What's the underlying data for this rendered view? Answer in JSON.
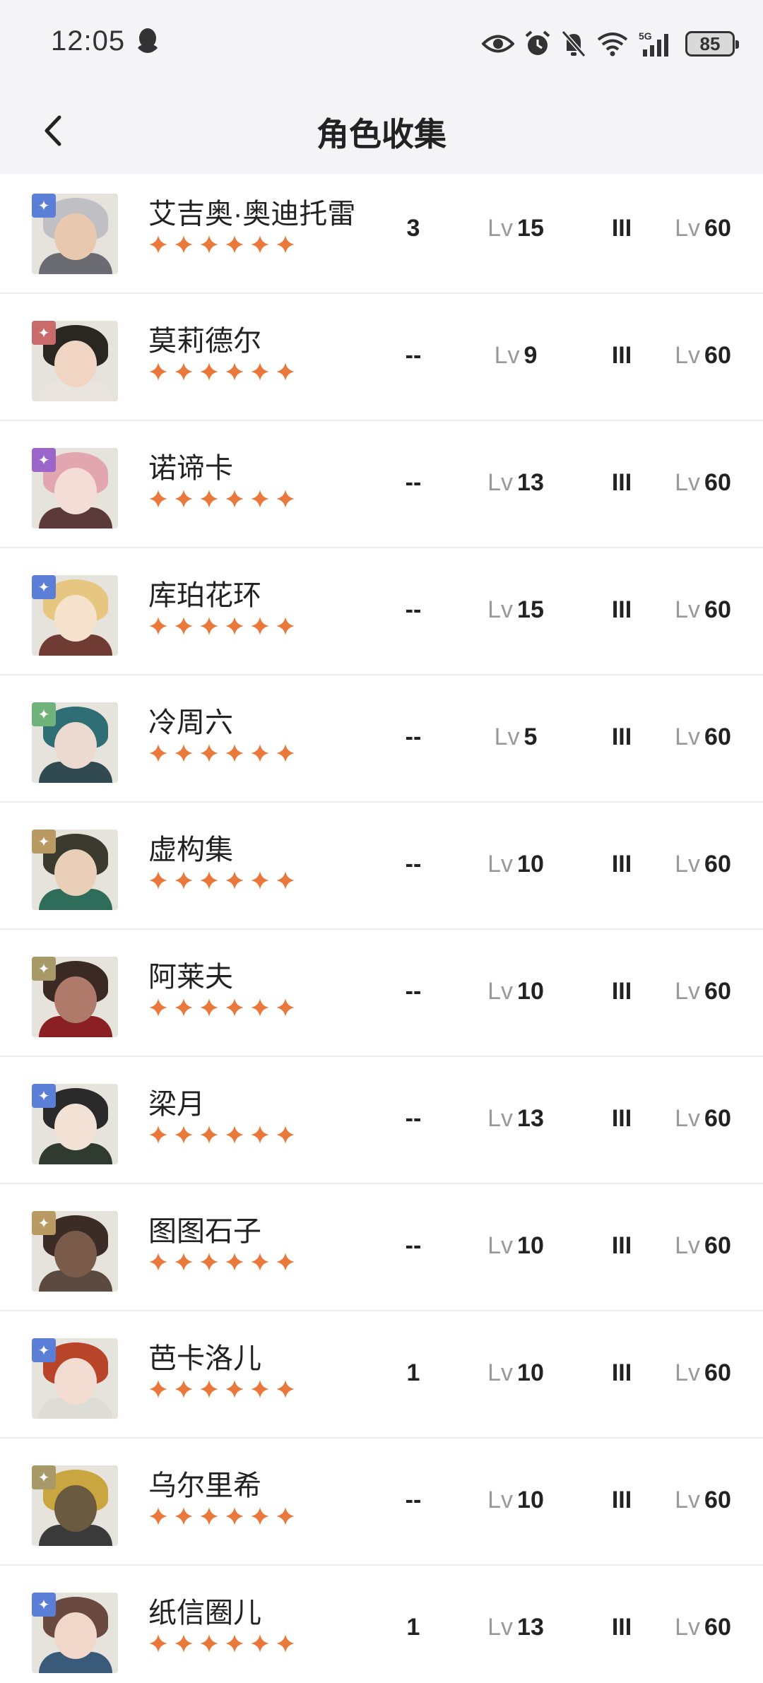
{
  "status_bar": {
    "time": "12:05",
    "battery": "85",
    "icons": [
      "qq-icon",
      "eye-icon",
      "alarm-icon",
      "bell-off-icon",
      "wifi-icon",
      "5g-icon",
      "signal-icon",
      "battery-icon"
    ]
  },
  "header": {
    "title": "角色收集",
    "back_icon": "chevron-left-icon"
  },
  "colors": {
    "star": "#e9783a",
    "divider": "#ececec",
    "element_blue": "#5b7fd6",
    "element_red": "#c96b6b",
    "element_purple": "#9b65c9",
    "element_green": "#6fb27a",
    "element_gold": "#b89a62"
  },
  "lv_prefix": "Lv",
  "characters": [
    {
      "name": "艾吉奥·奥迪托雷",
      "element": "star-element-icon",
      "element_color": "#5b7fd6",
      "rank": "3",
      "level": "15",
      "insight": "III",
      "max_level": "60",
      "stars": 6
    },
    {
      "name": "莫莉德尔",
      "element": "beast-element-icon",
      "element_color": "#c96b6b",
      "rank": "--",
      "level": "9",
      "insight": "III",
      "max_level": "60",
      "stars": 6
    },
    {
      "name": "诺谛卡",
      "element": "spirit-element-icon",
      "element_color": "#9b65c9",
      "rank": "--",
      "level": "13",
      "insight": "III",
      "max_level": "60",
      "stars": 6
    },
    {
      "name": "库珀花环",
      "element": "star-element-icon",
      "element_color": "#5b7fd6",
      "rank": "--",
      "level": "15",
      "insight": "III",
      "max_level": "60",
      "stars": 6
    },
    {
      "name": "冷周六",
      "element": "plant-element-icon",
      "element_color": "#6fb27a",
      "rank": "--",
      "level": "5",
      "insight": "III",
      "max_level": "60",
      "stars": 6
    },
    {
      "name": "虚构集",
      "element": "mineral-element-icon",
      "element_color": "#b89a62",
      "rank": "--",
      "level": "10",
      "insight": "III",
      "max_level": "60",
      "stars": 6
    },
    {
      "name": "阿莱夫",
      "element": "intellect-element-icon",
      "element_color": "#a89a68",
      "rank": "--",
      "level": "10",
      "insight": "III",
      "max_level": "60",
      "stars": 6
    },
    {
      "name": "梁月",
      "element": "star-element-icon",
      "element_color": "#5b7fd6",
      "rank": "--",
      "level": "13",
      "insight": "III",
      "max_level": "60",
      "stars": 6
    },
    {
      "name": "图图石子",
      "element": "mineral-element-icon",
      "element_color": "#b89a62",
      "rank": "--",
      "level": "10",
      "insight": "III",
      "max_level": "60",
      "stars": 6
    },
    {
      "name": "芭卡洛儿",
      "element": "star-element-icon",
      "element_color": "#5b7fd6",
      "rank": "1",
      "level": "10",
      "insight": "III",
      "max_level": "60",
      "stars": 6
    },
    {
      "name": "乌尔里希",
      "element": "intellect-element-icon",
      "element_color": "#a89a68",
      "rank": "--",
      "level": "10",
      "insight": "III",
      "max_level": "60",
      "stars": 6
    },
    {
      "name": "纸信圈儿",
      "element": "star-element-icon",
      "element_color": "#5b7fd6",
      "rank": "1",
      "level": "13",
      "insight": "III",
      "max_level": "60",
      "stars": 6
    }
  ]
}
